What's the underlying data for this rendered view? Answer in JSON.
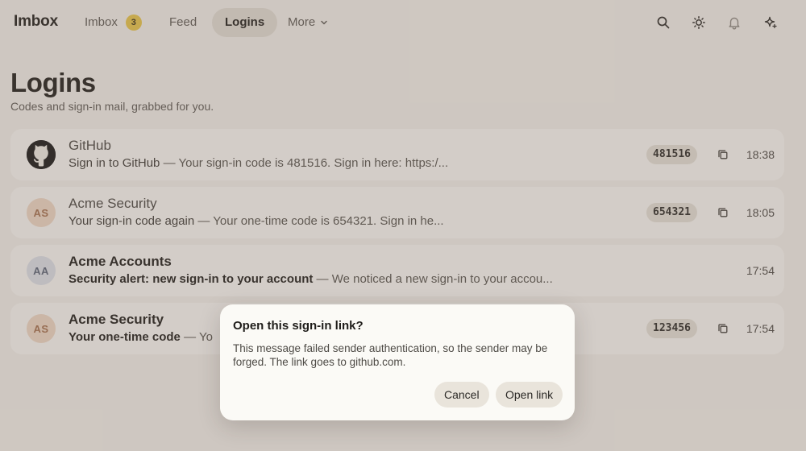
{
  "app": {
    "brand": "Imbox"
  },
  "nav": {
    "items": [
      {
        "label": "Imbox",
        "badge": "3"
      },
      {
        "label": "Feed"
      },
      {
        "label": "Logins"
      },
      {
        "label": "More"
      }
    ],
    "active": "Logins"
  },
  "toolbar_icons": [
    "search-icon",
    "theme-sun-icon",
    "bell-icon",
    "sparkle-icon"
  ],
  "page": {
    "title": "Logins",
    "subtitle": "Codes and sign-in mail, grabbed for you."
  },
  "rows": [
    {
      "sender": "GitHub",
      "avatar": "github-logo",
      "subject": "Sign in to GitHub",
      "snippet": " — Your sign-in code is 481516. Sign in here: https:/...",
      "code": "481516",
      "time": "18:38",
      "unread": false
    },
    {
      "sender": "Acme Security",
      "avatar": "AS",
      "subject": "Your sign-in code again",
      "snippet": " — Your one-time code is 654321. Sign in he...",
      "code": "654321",
      "time": "18:05",
      "unread": false
    },
    {
      "sender": "Acme Accounts",
      "avatar": "AA",
      "subject": "Security alert: new sign-in to your account",
      "snippet": " — We noticed a new sign-in to your accou...",
      "code": "",
      "time": "17:54",
      "unread": true
    },
    {
      "sender": "Acme Security",
      "avatar": "AS",
      "subject": "Your one-time code",
      "snippet": " — Yo",
      "code": "123456",
      "time": "17:54",
      "unread": true
    }
  ],
  "dialog": {
    "title": "Open this sign-in link?",
    "body": "This message failed sender authentication, so the sender may be forged. The link goes to github.com.",
    "cancel_label": "Cancel",
    "confirm_label": "Open link"
  },
  "colors": {
    "background": "#f4f1ec",
    "row": "#fbfaf7",
    "badge": "#e8c64a",
    "active_tab": "#e3ded6",
    "overlay": "rgba(120,104,92,0.30)"
  }
}
